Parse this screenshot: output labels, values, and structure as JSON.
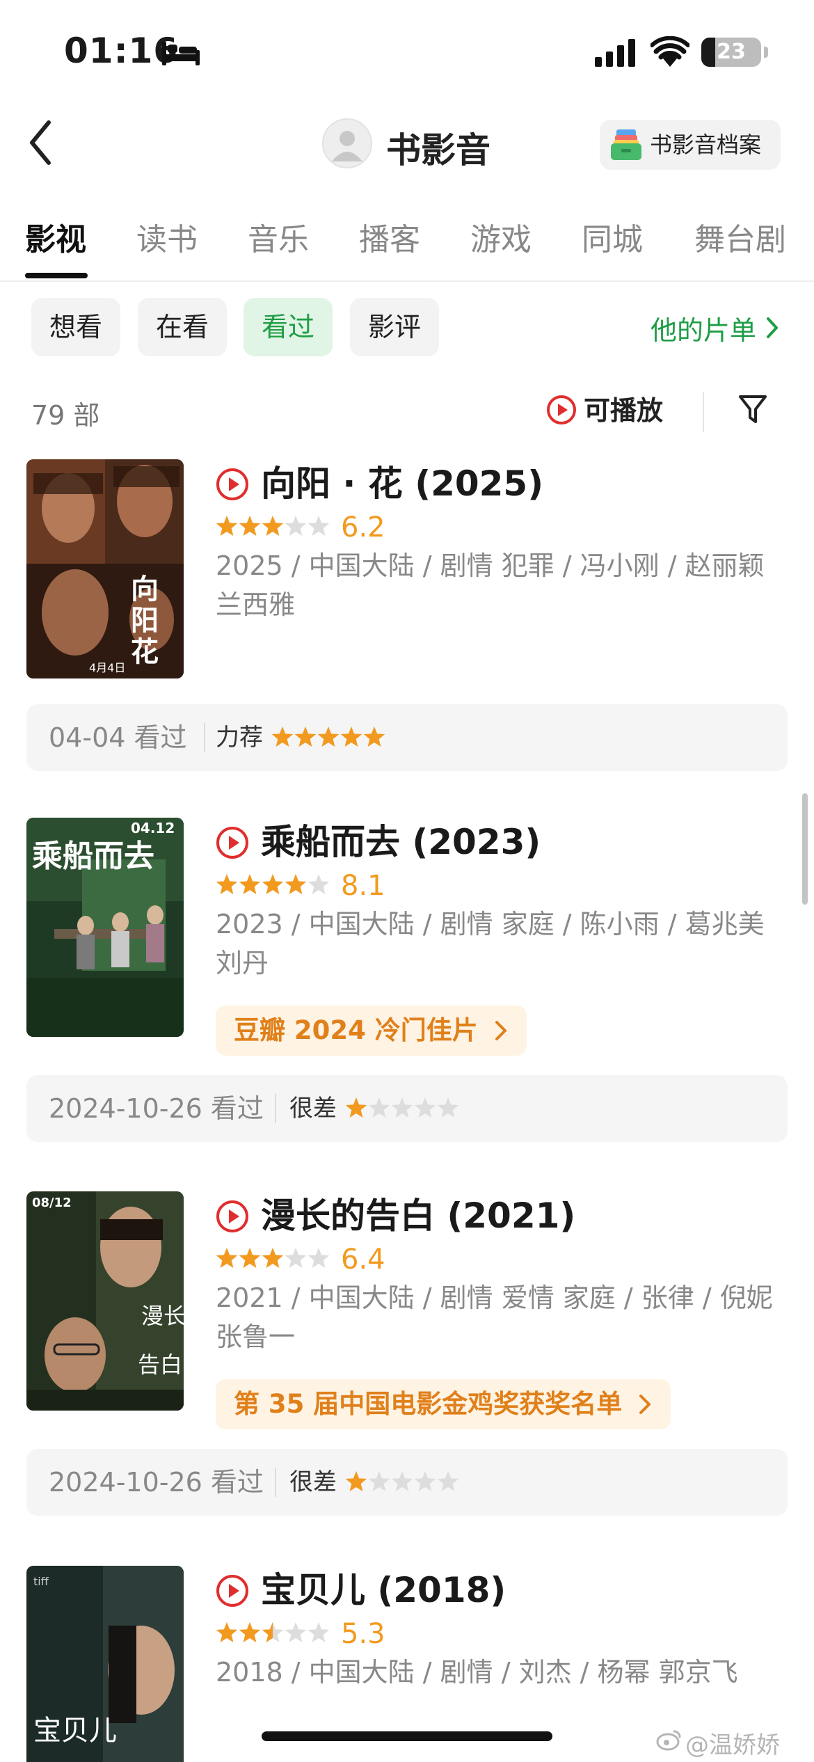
{
  "status_bar": {
    "time": "01:16",
    "battery_level": "23",
    "battery_fraction": 0.23,
    "icons": [
      "bed-icon",
      "cellular-signal-icon",
      "wifi-icon",
      "battery-icon"
    ]
  },
  "nav": {
    "back_icon": "chevron-left-icon",
    "title": "书影音",
    "archive_button": "书影音档案"
  },
  "tabs": [
    {
      "label": "影视",
      "active": true
    },
    {
      "label": "读书",
      "active": false
    },
    {
      "label": "音乐",
      "active": false
    },
    {
      "label": "播客",
      "active": false
    },
    {
      "label": "游戏",
      "active": false
    },
    {
      "label": "同城",
      "active": false
    },
    {
      "label": "舞台剧",
      "active": false
    }
  ],
  "filters": {
    "chips": [
      {
        "label": "想看",
        "active": false
      },
      {
        "label": "在看",
        "active": false
      },
      {
        "label": "看过",
        "active": true
      },
      {
        "label": "影评",
        "active": false
      }
    ],
    "playlist_link": "他的片单"
  },
  "list_header": {
    "count": "79 部",
    "playable_label": "可播放",
    "filter_icon": "filter-funnel-icon"
  },
  "colors": {
    "accent_green": "#1f9d46",
    "star_orange": "#f29a1f",
    "play_red": "#e02e2e",
    "tag_orange": "#e0801a"
  },
  "movies": [
    {
      "title": "向阳 · 花 (2025)",
      "stars": 3,
      "score": "6.2",
      "meta": "2025 / 中国大陆 / 剧情 犯罪 / 冯小刚 / 赵丽颖 兰西雅",
      "tag": "",
      "watched_date": "04-04 看过",
      "user_rating_label": "力荐",
      "user_rating": 5
    },
    {
      "title": "乘船而去 (2023)",
      "stars": 4,
      "score": "8.1",
      "meta": "2023 / 中国大陆 / 剧情 家庭 / 陈小雨 / 葛兆美 刘丹",
      "tag": "豆瓣 2024 冷门佳片",
      "watched_date": "2024-10-26 看过",
      "user_rating_label": "很差",
      "user_rating": 1
    },
    {
      "title": "漫长的告白 (2021)",
      "stars": 3,
      "score": "6.4",
      "meta": "2021 / 中国大陆 / 剧情 爱情 家庭 / 张律 / 倪妮 张鲁一",
      "tag": "第 35 届中国电影金鸡奖获奖名单",
      "watched_date": "2024-10-26 看过",
      "user_rating_label": "很差",
      "user_rating": 1
    },
    {
      "title": "宝贝儿 (2018)",
      "stars": 2.5,
      "score": "5.3",
      "meta": "2018 / 中国大陆 / 剧情 / 刘杰 / 杨幂 郭京飞",
      "tag": "",
      "watched_date": "",
      "user_rating_label": "",
      "user_rating": 0
    }
  ],
  "watermark": "@温娇娇"
}
